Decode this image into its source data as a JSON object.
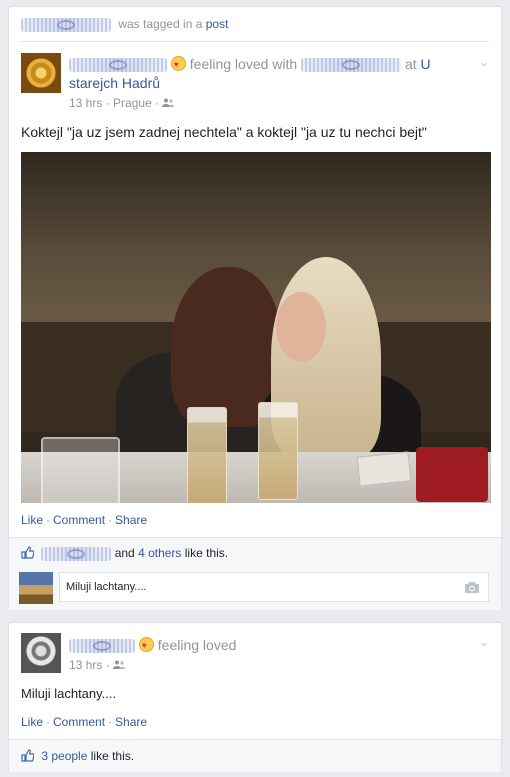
{
  "feed": [
    {
      "tag_line": "was tagged in a",
      "tag_link": "post",
      "feeling": "feeling loved with",
      "at_word": "at",
      "place": "U starejch Hadrů",
      "time": "13 hrs",
      "location": "Prague",
      "privacy_icon": "friends-icon",
      "text": "Koktejl \"ja uz jsem zadnej nechtela\" a koktejl \"ja uz tu nechci bejt\"",
      "actions": {
        "like": "Like",
        "comment": "Comment",
        "share": "Share"
      },
      "likes": {
        "and": "and",
        "others_link": "4 others",
        "suffix": "like this."
      },
      "comment": {
        "value": "Miluji lachtany...."
      }
    },
    {
      "feeling": "feeling loved",
      "time": "13 hrs",
      "privacy_icon": "friends-icon",
      "text": "Miluji lachtany....",
      "actions": {
        "like": "Like",
        "comment": "Comment",
        "share": "Share"
      },
      "likes": {
        "people_link": "3 people",
        "suffix": "like this."
      }
    }
  ],
  "colors": {
    "link": "#365899",
    "meta": "#90949c",
    "background": "#e9ebee"
  }
}
